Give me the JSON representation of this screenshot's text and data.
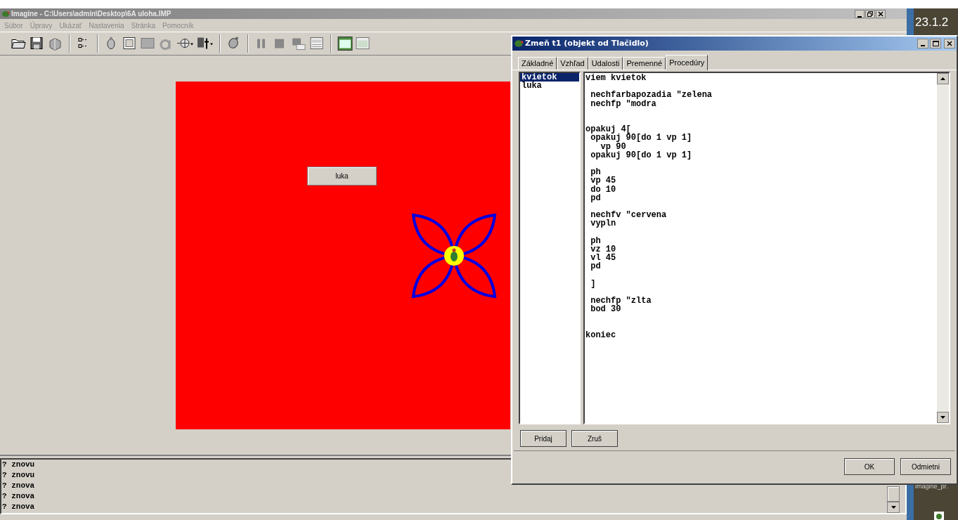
{
  "window": {
    "title": "Imagine - C:\\Users\\admin\\Desktop\\6A uloha.IMP"
  },
  "menu": [
    "Súbor",
    "Úpravy",
    "Ukázať",
    "Nastavenia",
    "Stránka",
    "Pomocník"
  ],
  "canvas": {
    "button_label": "luka"
  },
  "console_lines": [
    "? znovu",
    "? znovu",
    "? znova",
    "? znova",
    "? znova"
  ],
  "desktop": {
    "clock": "23.1.2",
    "icon_label": "imagine_pr."
  },
  "dialog": {
    "title": "Zmeň t1 (objekt od Tlačidlo)",
    "tabs": [
      {
        "label": "Základné",
        "selected": false
      },
      {
        "label": "Vzhľad",
        "selected": false
      },
      {
        "label": "Udalosti",
        "selected": false
      },
      {
        "label": "Premenné",
        "selected": false
      },
      {
        "label": "Procedúry",
        "selected": true
      }
    ],
    "procedures": [
      {
        "name": "kvietok",
        "selected": true
      },
      {
        "name": "luka",
        "selected": false
      }
    ],
    "code": "viem kvietok\n\n nechfarbapozadia \"zelena\n nechfp \"modra\n\n\nopakuj 4[\n opakuj 90[do 1 vp 1]\n   vp 90\n opakuj 90[do 1 vp 1]\n\n ph\n vp 45\n do 10\n pd\n\n nechfv \"cervena\n vypln\n\n ph\n vz 10\n vl 45\n pd\n\n ]\n\n nechfp \"zlta\n bod 30\n\n\nkoniec",
    "buttons": [
      "Pridaj",
      "Zruš"
    ],
    "footer_buttons": [
      "OK",
      "Odmietni"
    ]
  }
}
